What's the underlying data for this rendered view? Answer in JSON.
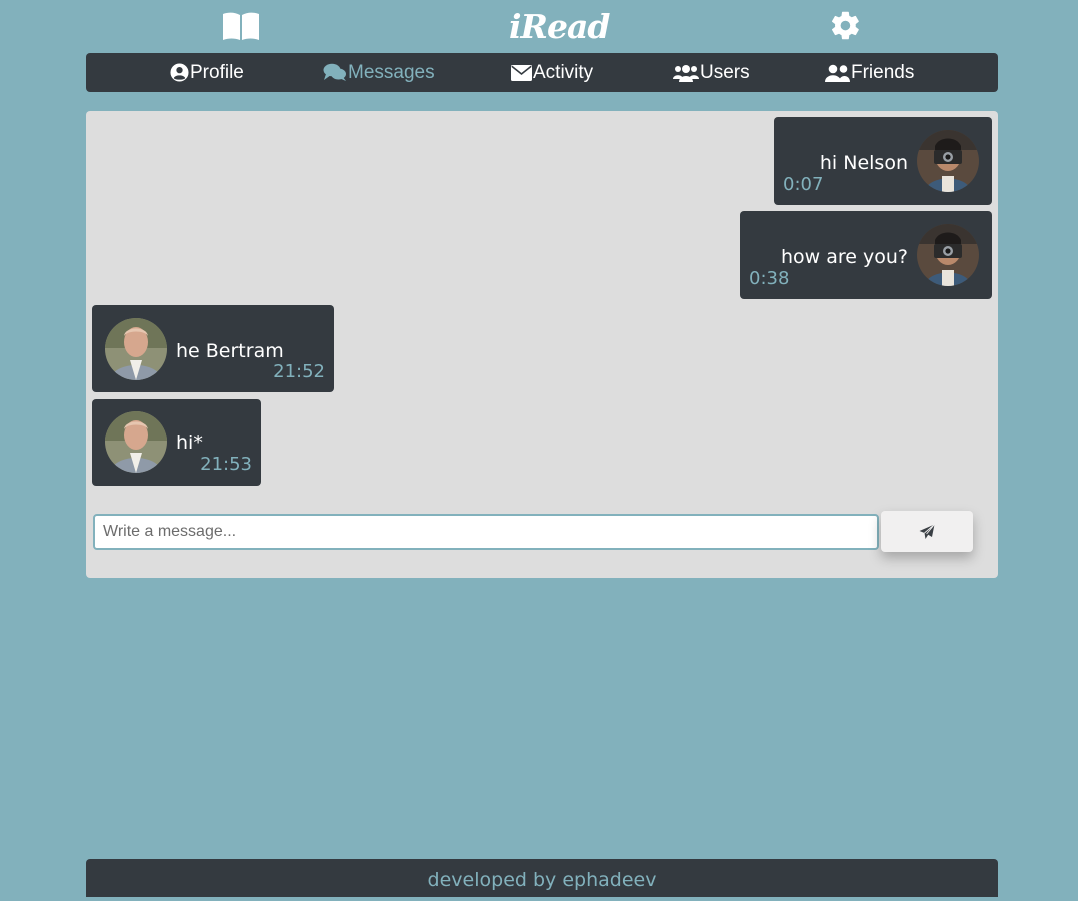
{
  "header": {
    "logo_text": "iRead",
    "book_icon": "book-icon",
    "settings_icon": "gear-icon"
  },
  "nav": {
    "items": [
      {
        "label": "Profile",
        "icon": "user-circle-icon"
      },
      {
        "label": "Messages",
        "icon": "comments-icon",
        "active": true
      },
      {
        "label": "Activity",
        "icon": "envelope-icon"
      },
      {
        "label": "Users",
        "icon": "users-icon"
      },
      {
        "label": "Friends",
        "icon": "user-friends-icon"
      }
    ]
  },
  "messages": [
    {
      "text": "hi Nelson",
      "time": "0:07",
      "side": "right"
    },
    {
      "text": "how are you?",
      "time": "0:38",
      "side": "right"
    },
    {
      "text": "he Bertram",
      "time": "21:52",
      "side": "left"
    },
    {
      "text": "hi*",
      "time": "21:53",
      "side": "left"
    }
  ],
  "composer": {
    "placeholder": "Write a message...",
    "send_icon": "paper-plane-icon"
  },
  "footer": {
    "text": "developed by ephadeev"
  },
  "colors": {
    "background": "#82b1bc",
    "dark": "#343a40",
    "accent": "#82b1bc",
    "chat_panel": "#dddddd"
  }
}
